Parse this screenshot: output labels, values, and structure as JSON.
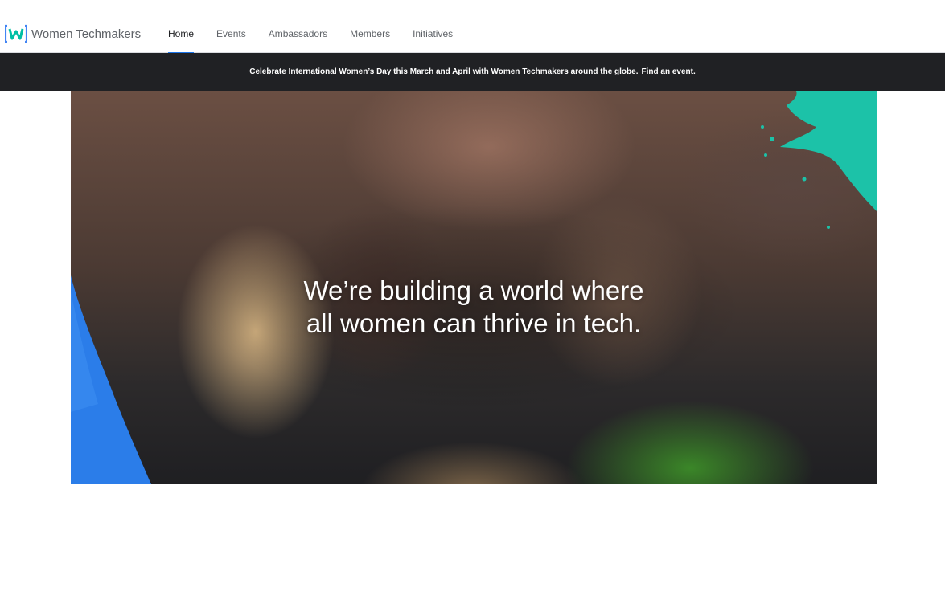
{
  "header": {
    "brand": {
      "name": "Women Techmakers",
      "logo_icon": "wtm-logo-icon",
      "logo_colors": [
        "#4285f4",
        "#00bfa5"
      ]
    },
    "nav": {
      "tabs": [
        {
          "label": "Home",
          "active": true
        },
        {
          "label": "Events",
          "active": false
        },
        {
          "label": "Ambassadors",
          "active": false
        },
        {
          "label": "Members",
          "active": false
        },
        {
          "label": "Initiatives",
          "active": false
        }
      ]
    }
  },
  "announcement": {
    "text": "Celebrate International Women’s Day this March and April with Women Techmakers around the globe.",
    "link_label": "Find an event",
    "suffix": "."
  },
  "hero": {
    "headline_line1": "We’re building a world where",
    "headline_line2": "all women can thrive in tech.",
    "accent_blue": "#2b7de9",
    "accent_teal": "#1cc2a8"
  }
}
